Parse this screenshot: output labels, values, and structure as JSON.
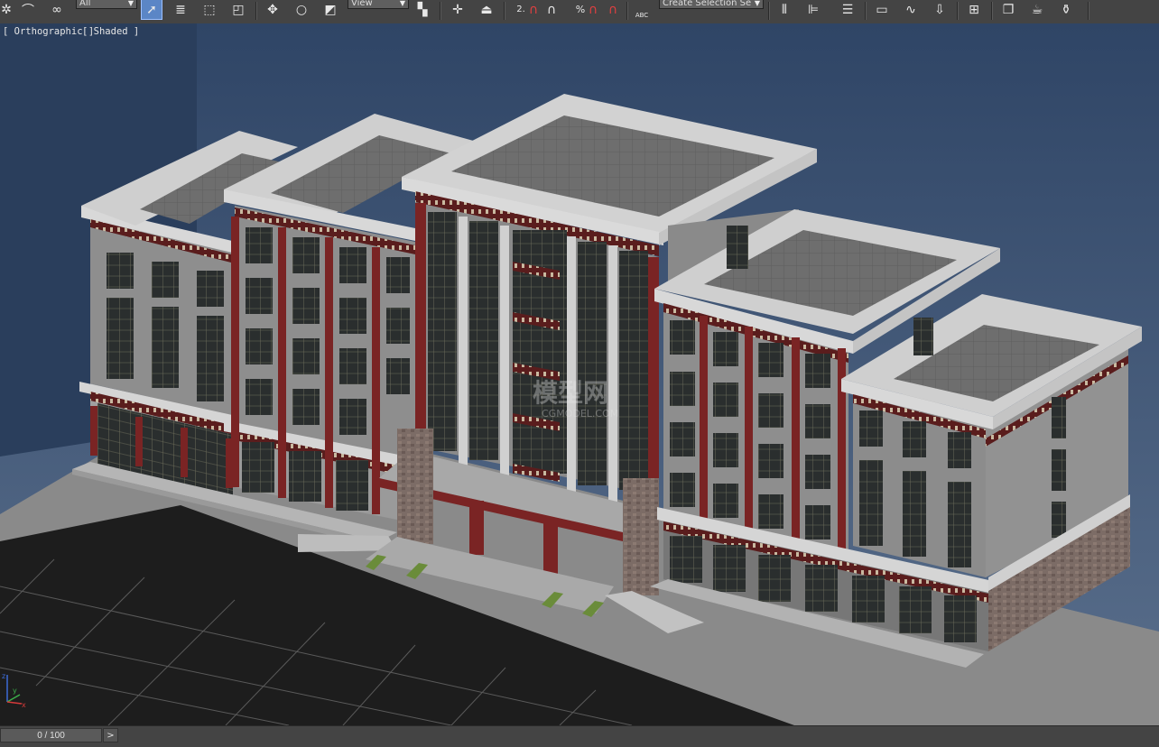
{
  "toolbar": {
    "selection_filter": "All",
    "reference_coord": "View",
    "named_selection": "Create Selection Se",
    "snap_angle_label": "2.",
    "percent_snap_label": "%",
    "spell_label": "ABC"
  },
  "viewport": {
    "pov_label": "Orthographic",
    "shading_label": "Shaded",
    "watermark_brand": "模型网",
    "watermark_url": "CGMODEL.COM",
    "axis_labels": [
      "x",
      "y",
      "z"
    ]
  },
  "timeline": {
    "frame_display": "0 / 100",
    "next_arrow": ">"
  },
  "colors": {
    "toolbar_bg": "#444444",
    "active_tool": "#5b86c6",
    "viewport_bg_top": "#2f4566",
    "viewport_bg_bottom": "#5a6f8c",
    "wall_gray": "#8e8e8e",
    "trim_red": "#7a2424",
    "parapet_white": "#d9d9d9",
    "stone_base": "#7a6a64"
  },
  "icons": [
    "select-link-icon",
    "unlink-icon",
    "bind-spacewarp-icon",
    "select-object-icon",
    "select-by-name-icon",
    "rect-region-icon",
    "window-crossing-icon",
    "move-icon",
    "rotate-icon",
    "scale-icon",
    "select-manipulate-icon",
    "use-pivot-icon",
    "keyboard-shortcut-icon",
    "snap-toggle-icon",
    "angle-snap-icon",
    "percent-snap-icon",
    "spinner-snap-icon",
    "edit-named-selection-icon",
    "mirror-icon",
    "align-icon",
    "layer-manager-icon",
    "curve-editor-icon",
    "schematic-view-icon",
    "material-editor-icon",
    "render-setup-icon",
    "rendered-frame-icon",
    "render-teapot-icon"
  ]
}
